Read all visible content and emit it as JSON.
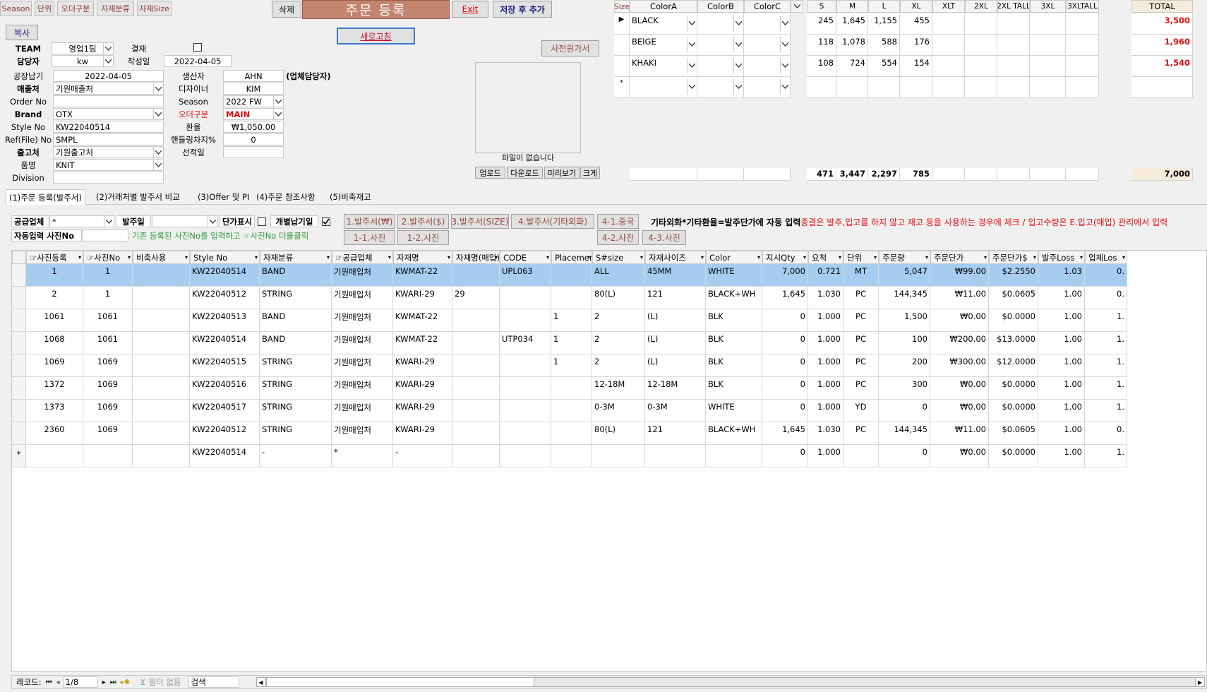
{
  "toolbar": {
    "season": "Season",
    "order_type": "단위",
    "order_type2": "오더구분",
    "material_class": "자재분류",
    "material_size": "자재Size",
    "delete": "삭제",
    "title": "주문 등록",
    "exit": "Exit",
    "save_add": "저장 후 추가",
    "copy": "복사",
    "refresh": "새로고침",
    "cost_sheet": "사전원가서"
  },
  "form": {
    "team_label": "TEAM",
    "team_value": "영업1팀",
    "approve_label": "결재",
    "manager_label": "담당자",
    "manager_value": "kw",
    "created_label": "작성일",
    "created_value": "2022-04-05",
    "factory_date_label": "공장납기",
    "factory_date_value": "2022-04-05",
    "producer_label": "생산자",
    "producer_value": "AHN",
    "vendor_manager": "(업체담당자)",
    "sales_label": "매출처",
    "sales_value": "기원매출처",
    "designer_label": "디자이너",
    "designer_value": "KIM",
    "orderno_label": "Order No",
    "orderno_value": "",
    "season_label": "Season",
    "season_value": "2022 FW",
    "brand_label": "Brand",
    "brand_value": "OTX",
    "ordertype_label": "오더구분",
    "ordertype_value": "MAIN",
    "styleno_label": "Style No",
    "styleno_value": "KW22040514",
    "rate_label": "환율",
    "rate_value": "₩1,050.00",
    "ref_label": "Ref(File) No",
    "ref_value": "SMPL",
    "handling_label": "핸들링차지%",
    "handling_value": "0",
    "ship_label": "출고처",
    "ship_value": "기원출고처",
    "shipdate_label": "선적일",
    "shipdate_value": "",
    "item_label": "품명",
    "item_value": "KNIT",
    "division_label": "Division",
    "division_value": ""
  },
  "photo": {
    "empty_text": "파일이 없습니다",
    "upload": "업로드",
    "download": "다운로드",
    "preview": "미리보기",
    "enlarge": "크게"
  },
  "size_grid": {
    "size_btn": "Size",
    "headers": [
      "ColorA",
      "ColorB",
      "ColorC"
    ],
    "sizes": [
      "S",
      "M",
      "L",
      "XL",
      "XLT",
      "2XL",
      "2XL TALL",
      "3XL",
      "3XLTALL"
    ],
    "total_label": "TOTAL",
    "rows": [
      {
        "color": "BLACK",
        "S": "245",
        "M": "1,645",
        "L": "1,155",
        "XL": "455",
        "total": "3,500"
      },
      {
        "color": "BEIGE",
        "S": "118",
        "M": "1,078",
        "L": "588",
        "XL": "176",
        "total": "1,960"
      },
      {
        "color": "KHAKI",
        "S": "108",
        "M": "724",
        "L": "554",
        "XL": "154",
        "total": "1,540"
      }
    ],
    "new_row_marker": "*",
    "totals": {
      "S": "471",
      "M": "3,447",
      "L": "2,297",
      "XL": "785",
      "total": "7,000"
    }
  },
  "tabs": [
    "(1)주문 등록(발주서)",
    "(2)거래처별 발주서 비교",
    "(3)Offer 및 PI",
    "(4)주문 참조사항",
    "(5)비축재고"
  ],
  "filters": {
    "supplier_label": "공급업체",
    "supplier_value": "*",
    "order_date_label": "발주일",
    "order_date_value": "",
    "unit_price_label": "단가표시",
    "individual_label": "개별납기일",
    "auto_photo_label": "자동입력 사진No",
    "auto_photo_value": "",
    "hint": "기존 등록된 사진No를 입력하고 ☞사진No 더블클릭"
  },
  "report_buttons": {
    "b1": "1.발주서(₩)",
    "b2": "2.발주서($)",
    "b3": "3.발주서(SIZE)",
    "b4": "4.발주서(기타외화)",
    "b41": "4-1.중국",
    "b42": "4-2.사진",
    "b43": "4-3.사진",
    "b11": "1-1.사진",
    "b12": "1-2.사진"
  },
  "notice": {
    "black": "기타외화*기타환율=발주단가에 자동 입력",
    "red": "종결은 발주,입고를 하지 않고 재고 등을 사용하는 경우에 체크 / 입고수량은 E.입고(매입) 관리에서 입력"
  },
  "grid": {
    "headers": [
      "☞사진등록",
      "☞사진No",
      "비축사용",
      "Style No",
      "자재분류",
      "☞공급업체",
      "자재명",
      "자재명(매입)",
      "CODE",
      "Placement",
      "S#size",
      "자재사이즈",
      "Color",
      "지시Qty",
      "요척",
      "단위",
      "주문량",
      "주문단가",
      "주문단가$",
      "발주Loss",
      "업체Los"
    ],
    "rows": [
      [
        "1",
        "1",
        "",
        "KW22040514",
        "BAND",
        "기원매입처",
        "KWMAT-22",
        "",
        "UPL063",
        "",
        "ALL",
        "45MM",
        "WHITE",
        "7,000",
        "0.721",
        "MT",
        "5,047",
        "₩99.00",
        "$2.2550",
        "1.03",
        "0."
      ],
      [
        "2",
        "1",
        "",
        "KW22040512",
        "STRING",
        "기원매입처",
        "KWARI-29",
        "29",
        "",
        "",
        "80(L)",
        "121",
        "BLACK+WH",
        "1,645",
        "1.030",
        "PC",
        "144,345",
        "₩11.00",
        "$0.0605",
        "1.00",
        "0."
      ],
      [
        "1061",
        "1061",
        "",
        "KW22040513",
        "BAND",
        "기원매입처",
        "KWMAT-22",
        "",
        "",
        "1",
        "2",
        "(L)",
        "BLK",
        "0",
        "1.000",
        "PC",
        "1,500",
        "₩0.00",
        "$0.0000",
        "1.00",
        "1."
      ],
      [
        "1068",
        "1061",
        "",
        "KW22040514",
        "BAND",
        "기원매입처",
        "KWMAT-22",
        "",
        "UTP034",
        "1",
        "2",
        "(L)",
        "BLK",
        "0",
        "1.000",
        "PC",
        "100",
        "₩200.00",
        "$13.0000",
        "1.00",
        "1."
      ],
      [
        "1069",
        "1069",
        "",
        "KW22040515",
        "STRING",
        "기원매입처",
        "KWARI-29",
        "",
        "",
        "1",
        "2",
        "(L)",
        "BLK",
        "0",
        "1.000",
        "PC",
        "200",
        "₩300.00",
        "$12.0000",
        "1.00",
        "1."
      ],
      [
        "1372",
        "1069",
        "",
        "KW22040516",
        "STRING",
        "기원매입처",
        "KWARI-29",
        "",
        "",
        "",
        "12-18M",
        "12-18M",
        "BLK",
        "0",
        "1.000",
        "PC",
        "300",
        "₩0.00",
        "$0.0000",
        "1.00",
        "1."
      ],
      [
        "1373",
        "1069",
        "",
        "KW22040517",
        "STRING",
        "기원매입처",
        "KWARI-29",
        "",
        "",
        "",
        "0-3M",
        "0-3M",
        "WHITE",
        "0",
        "1.000",
        "YD",
        "0",
        "₩0.00",
        "$0.0000",
        "1.00",
        "1."
      ],
      [
        "2360",
        "1069",
        "",
        "KW22040512",
        "STRING",
        "기원매입처",
        "KWARI-29",
        "",
        "",
        "",
        "80(L)",
        "121",
        "BLACK+WH",
        "1,645",
        "1.030",
        "PC",
        "144,345",
        "₩11.00",
        "$0.0605",
        "1.00",
        "0."
      ],
      [
        "",
        "",
        "",
        "KW22040514",
        "-",
        "*",
        "-",
        "",
        "",
        "",
        "",
        "",
        "",
        "0",
        "1.000",
        "",
        "0",
        "₩0.00",
        "$0.0000",
        "1.00",
        "1."
      ]
    ]
  },
  "statusbar": {
    "record_label": "레코드:",
    "record_value": "1/8",
    "filter": "필터 없음",
    "search": "검색"
  },
  "colors": {
    "accent_title": "#c0846e",
    "selected_row": "#a6cdf0",
    "notice_red": "#e01010"
  }
}
